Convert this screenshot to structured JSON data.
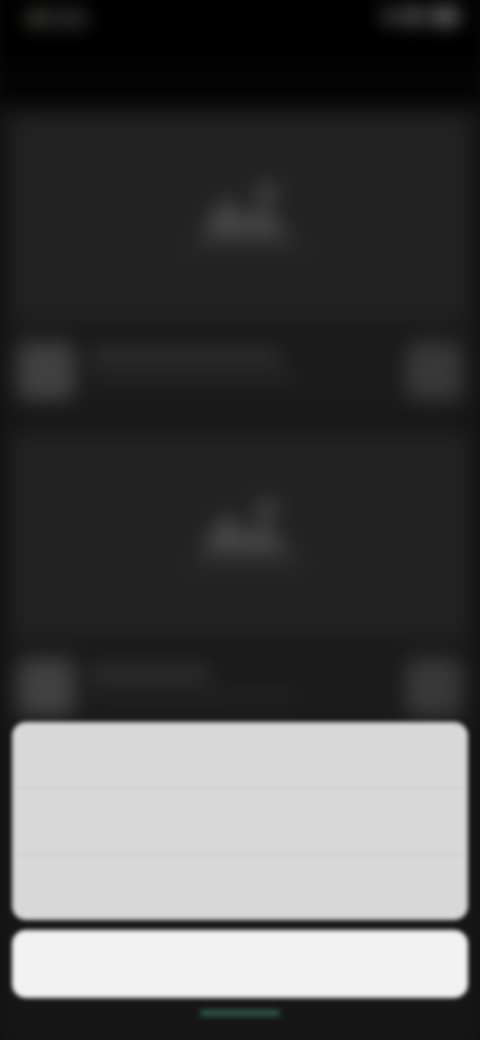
{
  "colors": {
    "accent": "#2a74ff",
    "sheet_bg": "#d8d8d8",
    "cancel_bg": "#f2f2f2",
    "app_bg": "#1b1b1b"
  },
  "status_bar": {
    "time": "9:41"
  },
  "topbar": {
    "title": ""
  },
  "action_sheet": {
    "options": [
      {
        "label": "",
        "icon": ""
      },
      {
        "label": ""
      }
    ],
    "cancel_label": ""
  }
}
